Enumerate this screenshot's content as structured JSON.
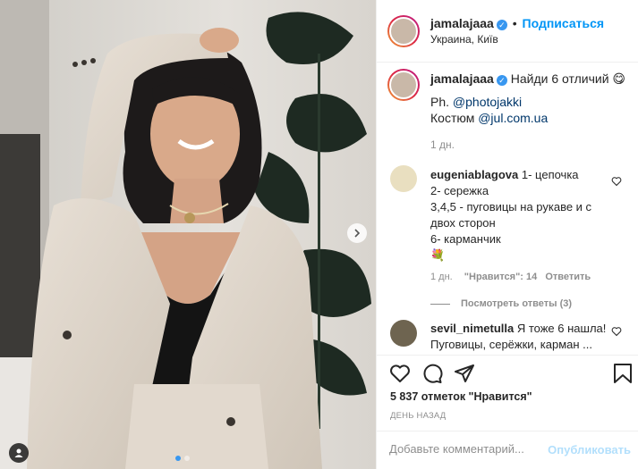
{
  "post": {
    "username": "jamalajaaa",
    "follow_label": "Подписаться",
    "separator": "•",
    "location": "Украина, Київ"
  },
  "caption": {
    "username": "jamalajaaa",
    "text": "Найди 6 отличий",
    "emoji": "😋",
    "credit1_prefix": "Ph.",
    "credit1_link": "@photojakki",
    "credit2_prefix": "Костюм",
    "credit2_link": "@jul.com.ua",
    "time": "1 дн."
  },
  "comments": [
    {
      "username": "eugeniablagova",
      "lines": [
        "1- цепочка",
        "2- сережка",
        "3,4,5 - пуговицы на рукаве и с",
        "двох сторон",
        "6- карманчик"
      ],
      "emoji": "💐",
      "time": "1 дн.",
      "likes": "\"Нравится\": 14",
      "reply": "Ответить",
      "view_replies": "Посмотреть ответы (3)"
    },
    {
      "username": "sevil_nimetulla",
      "line1": "Я тоже 6 нашла!",
      "line2": "Пуговицы, серёжки, карман ..."
    }
  ],
  "likes_text": "5 837 отметок \"Нравится\"",
  "date_text": "ДЕНЬ НАЗАД",
  "add_comment_placeholder": "Добавьте комментарий...",
  "publish_label": "Опубликовать",
  "colors": {
    "accent": "#0095f6",
    "verified": "#3897f0",
    "publish_disabled": "#b2dffc"
  },
  "icons": [
    "chevron-right-icon",
    "user-tag-icon",
    "verified-icon",
    "heart-icon",
    "comment-icon",
    "share-icon",
    "bookmark-icon"
  ],
  "carousel": {
    "slides": 2,
    "active": 1
  }
}
